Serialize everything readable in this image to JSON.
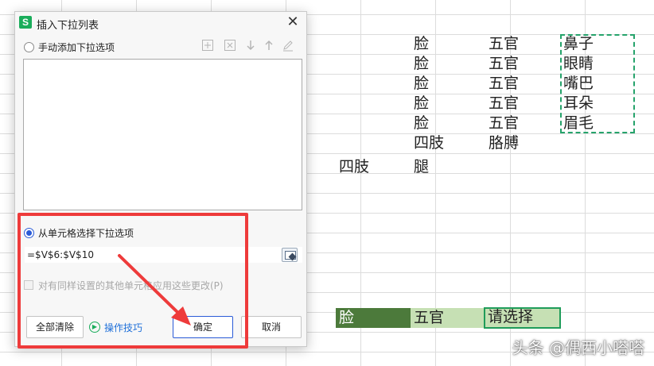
{
  "sheet": {
    "rows": [
      {
        "b": "脸",
        "c": "五官",
        "d": "鼻子"
      },
      {
        "b": "脸",
        "c": "五官",
        "d": "眼睛"
      },
      {
        "b": "脸",
        "c": "五官",
        "d": "嘴巴"
      },
      {
        "b": "脸",
        "c": "五官",
        "d": "耳朵"
      },
      {
        "b": "脸",
        "c": "五官",
        "d": "眉毛"
      },
      {
        "b": "四肢",
        "c": "胳膊"
      },
      {
        "a": "四肢",
        "b": "腿"
      }
    ],
    "dropdown_row": {
      "a": "脸",
      "b": "五官",
      "c": "请选择"
    }
  },
  "dialog": {
    "app_logo": "S",
    "title": "插入下拉列表",
    "close": "✕",
    "manual_option_label": "手动添加下拉选项",
    "toolbar_icons": [
      "add-item-icon",
      "delete-item-icon",
      "move-down-icon",
      "move-up-icon",
      "edit-icon"
    ],
    "cell_option_label": "从单元格选择下拉选项",
    "range_value": "=$V$6:$V$10",
    "apply_label": "对有同样设置的其他单元格应用这些更改(P)",
    "clear_all_button": "全部清除",
    "tips_link": "操作技巧",
    "ok_button": "确定",
    "cancel_button": "取消"
  },
  "watermark": "头条 @偶西小嗒嗒",
  "colors": {
    "annotation": "#ee3b3b",
    "accent": "#2a5bd7",
    "cell_dark": "#4c7a3b",
    "cell_light": "#c6e0b4"
  }
}
